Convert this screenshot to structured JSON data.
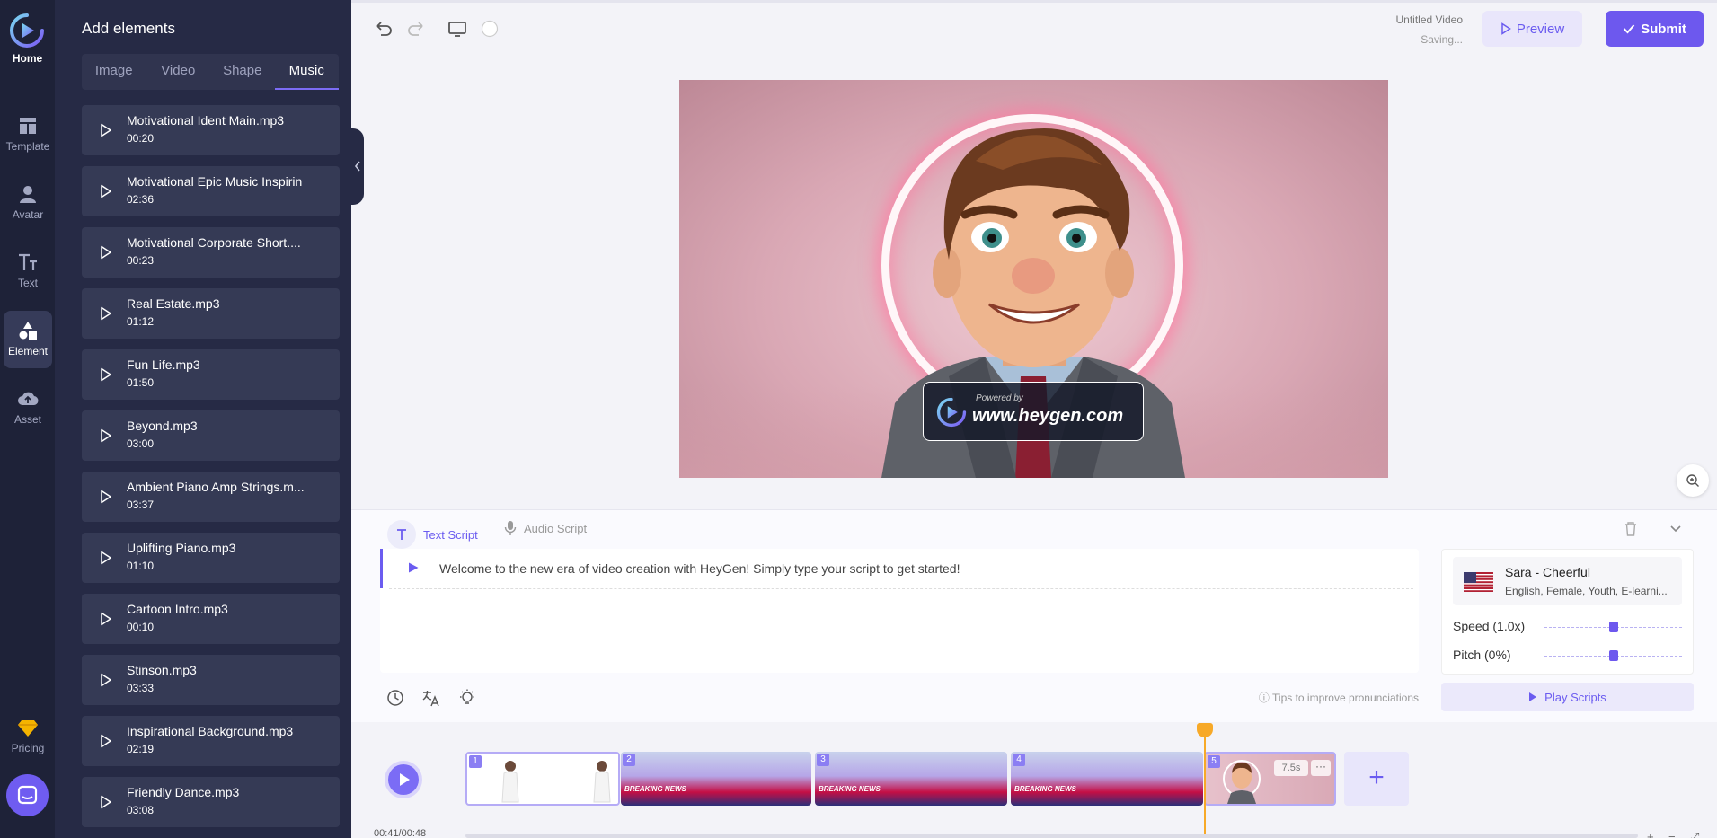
{
  "nav": {
    "home": "Home",
    "items": [
      {
        "label": "Template",
        "icon": "template-icon",
        "active": false
      },
      {
        "label": "Avatar",
        "icon": "avatar-icon",
        "active": false
      },
      {
        "label": "Text",
        "icon": "text-icon",
        "active": false
      },
      {
        "label": "Element",
        "icon": "element-icon",
        "active": true
      },
      {
        "label": "Asset",
        "icon": "upload-cloud-icon",
        "active": false
      }
    ],
    "pricing": "Pricing"
  },
  "panel": {
    "title": "Add elements",
    "tabs": [
      "Image",
      "Video",
      "Shape",
      "Music"
    ],
    "active_tab": "Music",
    "music": [
      {
        "name": "Motivational Ident Main.mp3",
        "duration": "00:20"
      },
      {
        "name": "Motivational Epic Music Inspirin",
        "duration": "02:36"
      },
      {
        "name": "Motivational Corporate Short....",
        "duration": "00:23"
      },
      {
        "name": "Real Estate.mp3",
        "duration": "01:12"
      },
      {
        "name": "Fun Life.mp3",
        "duration": "01:50"
      },
      {
        "name": "Beyond.mp3",
        "duration": "03:00"
      },
      {
        "name": "Ambient Piano Amp Strings.m...",
        "duration": "03:37"
      },
      {
        "name": "Uplifting Piano.mp3",
        "duration": "01:10"
      },
      {
        "name": "Cartoon Intro.mp3",
        "duration": "00:10"
      },
      {
        "name": "Stinson.mp3",
        "duration": "03:33"
      },
      {
        "name": "Inspirational Background.mp3",
        "duration": "02:19"
      },
      {
        "name": "Friendly Dance.mp3",
        "duration": "03:08"
      }
    ]
  },
  "header": {
    "video_title": "Untitled Video",
    "status": "Saving...",
    "preview_label": "Preview",
    "submit_label": "Submit"
  },
  "canvas": {
    "watermark_small": "Powered by",
    "watermark_url": "www.heygen.com"
  },
  "script": {
    "text_tab": "Text Script",
    "audio_tab": "Audio Script",
    "line": "Welcome to the new era of video creation with HeyGen! Simply type your script to get started!",
    "tips": "Tips to improve pronunciations",
    "play_scripts": "Play Scripts"
  },
  "voice": {
    "name": "Sara - Cheerful",
    "description": "English, Female, Youth, E-learni...",
    "speed_label": "Speed (1.0x)",
    "pitch_label": "Pitch (0%)",
    "speed_value": 1.0,
    "pitch_value": 0
  },
  "timeline": {
    "time": "00:41/00:48",
    "scenes": [
      {
        "num": "1"
      },
      {
        "num": "2",
        "caption": "BREAKING NEWS"
      },
      {
        "num": "3",
        "caption": "BREAKING NEWS"
      },
      {
        "num": "4",
        "caption": "BREAKING NEWS"
      },
      {
        "num": "5",
        "duration": "7.5s",
        "more": "···"
      }
    ],
    "add_label": "+"
  },
  "colors": {
    "accent": "#6d58ee",
    "rail_bg": "#1e2238",
    "panel_bg": "#262a45",
    "playhead": "#f7a928"
  }
}
